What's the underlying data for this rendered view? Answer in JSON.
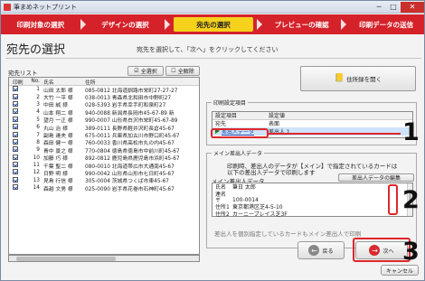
{
  "window": {
    "title": "筆まめネットプリント"
  },
  "steps": [
    "印刷対象の選択",
    "デザインの選択",
    "宛先の選択",
    "プレビューの確認",
    "印刷データの送信"
  ],
  "active_step": 2,
  "page": {
    "title": "宛先の選択",
    "instruction": "宛先を選択して、「次へ」をクリックしてください"
  },
  "list": {
    "label": "宛先リスト",
    "select_all": "全選択",
    "clear_all": "全解除",
    "headers": {
      "print": "印刷",
      "no": "No.",
      "name": "氏名",
      "address": "住所"
    },
    "rows": [
      {
        "no": "1",
        "name": "山田 太郎 様",
        "addr": "085-0812 北海道釧路市栄町27-27-27"
      },
      {
        "no": "2",
        "name": "大竹 一平 様",
        "addr": "038-0013 青森県北和田市中野町27"
      },
      {
        "no": "3",
        "name": "中田 誠 様",
        "addr": "028-5393 岩手県幸手町和泉町27"
      },
      {
        "no": "4",
        "name": "山本 翔二 様",
        "addr": "940-0088 新潟県長岡市45-67-89 新"
      },
      {
        "no": "5",
        "name": "望月 一正 様",
        "addr": "990-0007 山形県白沢市栄町45-67-89"
      },
      {
        "no": "6",
        "name": "丸山 治 様",
        "addr": "389-0111 長野県軽井沢町長倉45-67"
      },
      {
        "no": "7",
        "name": "副島 達夫 様",
        "addr": "675-0011 兵庫県加古川市野口町45-67"
      },
      {
        "no": "8",
        "name": "森田 健一 様",
        "addr": "760-0033 香川県高松市丸の内45-67"
      },
      {
        "no": "9",
        "name": "青中 景之 様",
        "addr": "770-0804 徳島県徳島市中前川町45-67"
      },
      {
        "no": "10",
        "name": "加藤 巧 様",
        "addr": "892-0812 鹿児島県鹿児島市浜町45-67"
      },
      {
        "no": "11",
        "name": "千葉 聖二 様",
        "addr": "080-0010 北海道帯広市大通南45-67"
      },
      {
        "no": "12",
        "name": "日野 明 様",
        "addr": "990-0042 山形県山形市七日町45-67"
      },
      {
        "no": "13",
        "name": "見島 行信 様",
        "addr": "305-0004 茨城県つくば市東45-67"
      },
      {
        "no": "14",
        "name": "森越 文男 様",
        "addr": "025-0090 岩手県花巻市石神町45-67"
      }
    ]
  },
  "address_book_button": "住所録を開く",
  "print_settings": {
    "label": "印刷設定項目",
    "headers": {
      "item": "設定項目",
      "value": "設定値"
    },
    "rows": [
      {
        "item": "宛先",
        "value": "表面"
      },
      {
        "item": "差出人データ",
        "value": "差出人 1"
      }
    ]
  },
  "sender": {
    "label": "メイン差出人データ",
    "note_line1": "印刷時、差出人のデータが【メイン】で指定されているカードは",
    "note_line2": "以下の差出人データで印刷します",
    "field_label": "メイン差出人データ",
    "edit_button": "差出人データの編集",
    "fields": [
      {
        "k": "氏名",
        "v": "筆日 太郎"
      },
      {
        "k": "連名",
        "v": ""
      },
      {
        "k": "〒",
        "v": "100-0014"
      },
      {
        "k": "住所1",
        "v": "東京都港区芝4-5-10"
      },
      {
        "k": "住所2",
        "v": "カーニープレイス芝3F"
      }
    ],
    "footer_note": "差出人を個別指定しているカードもメイン差出人で印刷"
  },
  "nav": {
    "back": "戻る",
    "next": "次へ",
    "cancel": "キャンセル"
  },
  "callouts": [
    "1",
    "2",
    "3"
  ],
  "colors": {
    "accent_red": "#d5222a",
    "active_step_yellow": "#f6d21c",
    "callout_red": "#e0262b"
  }
}
